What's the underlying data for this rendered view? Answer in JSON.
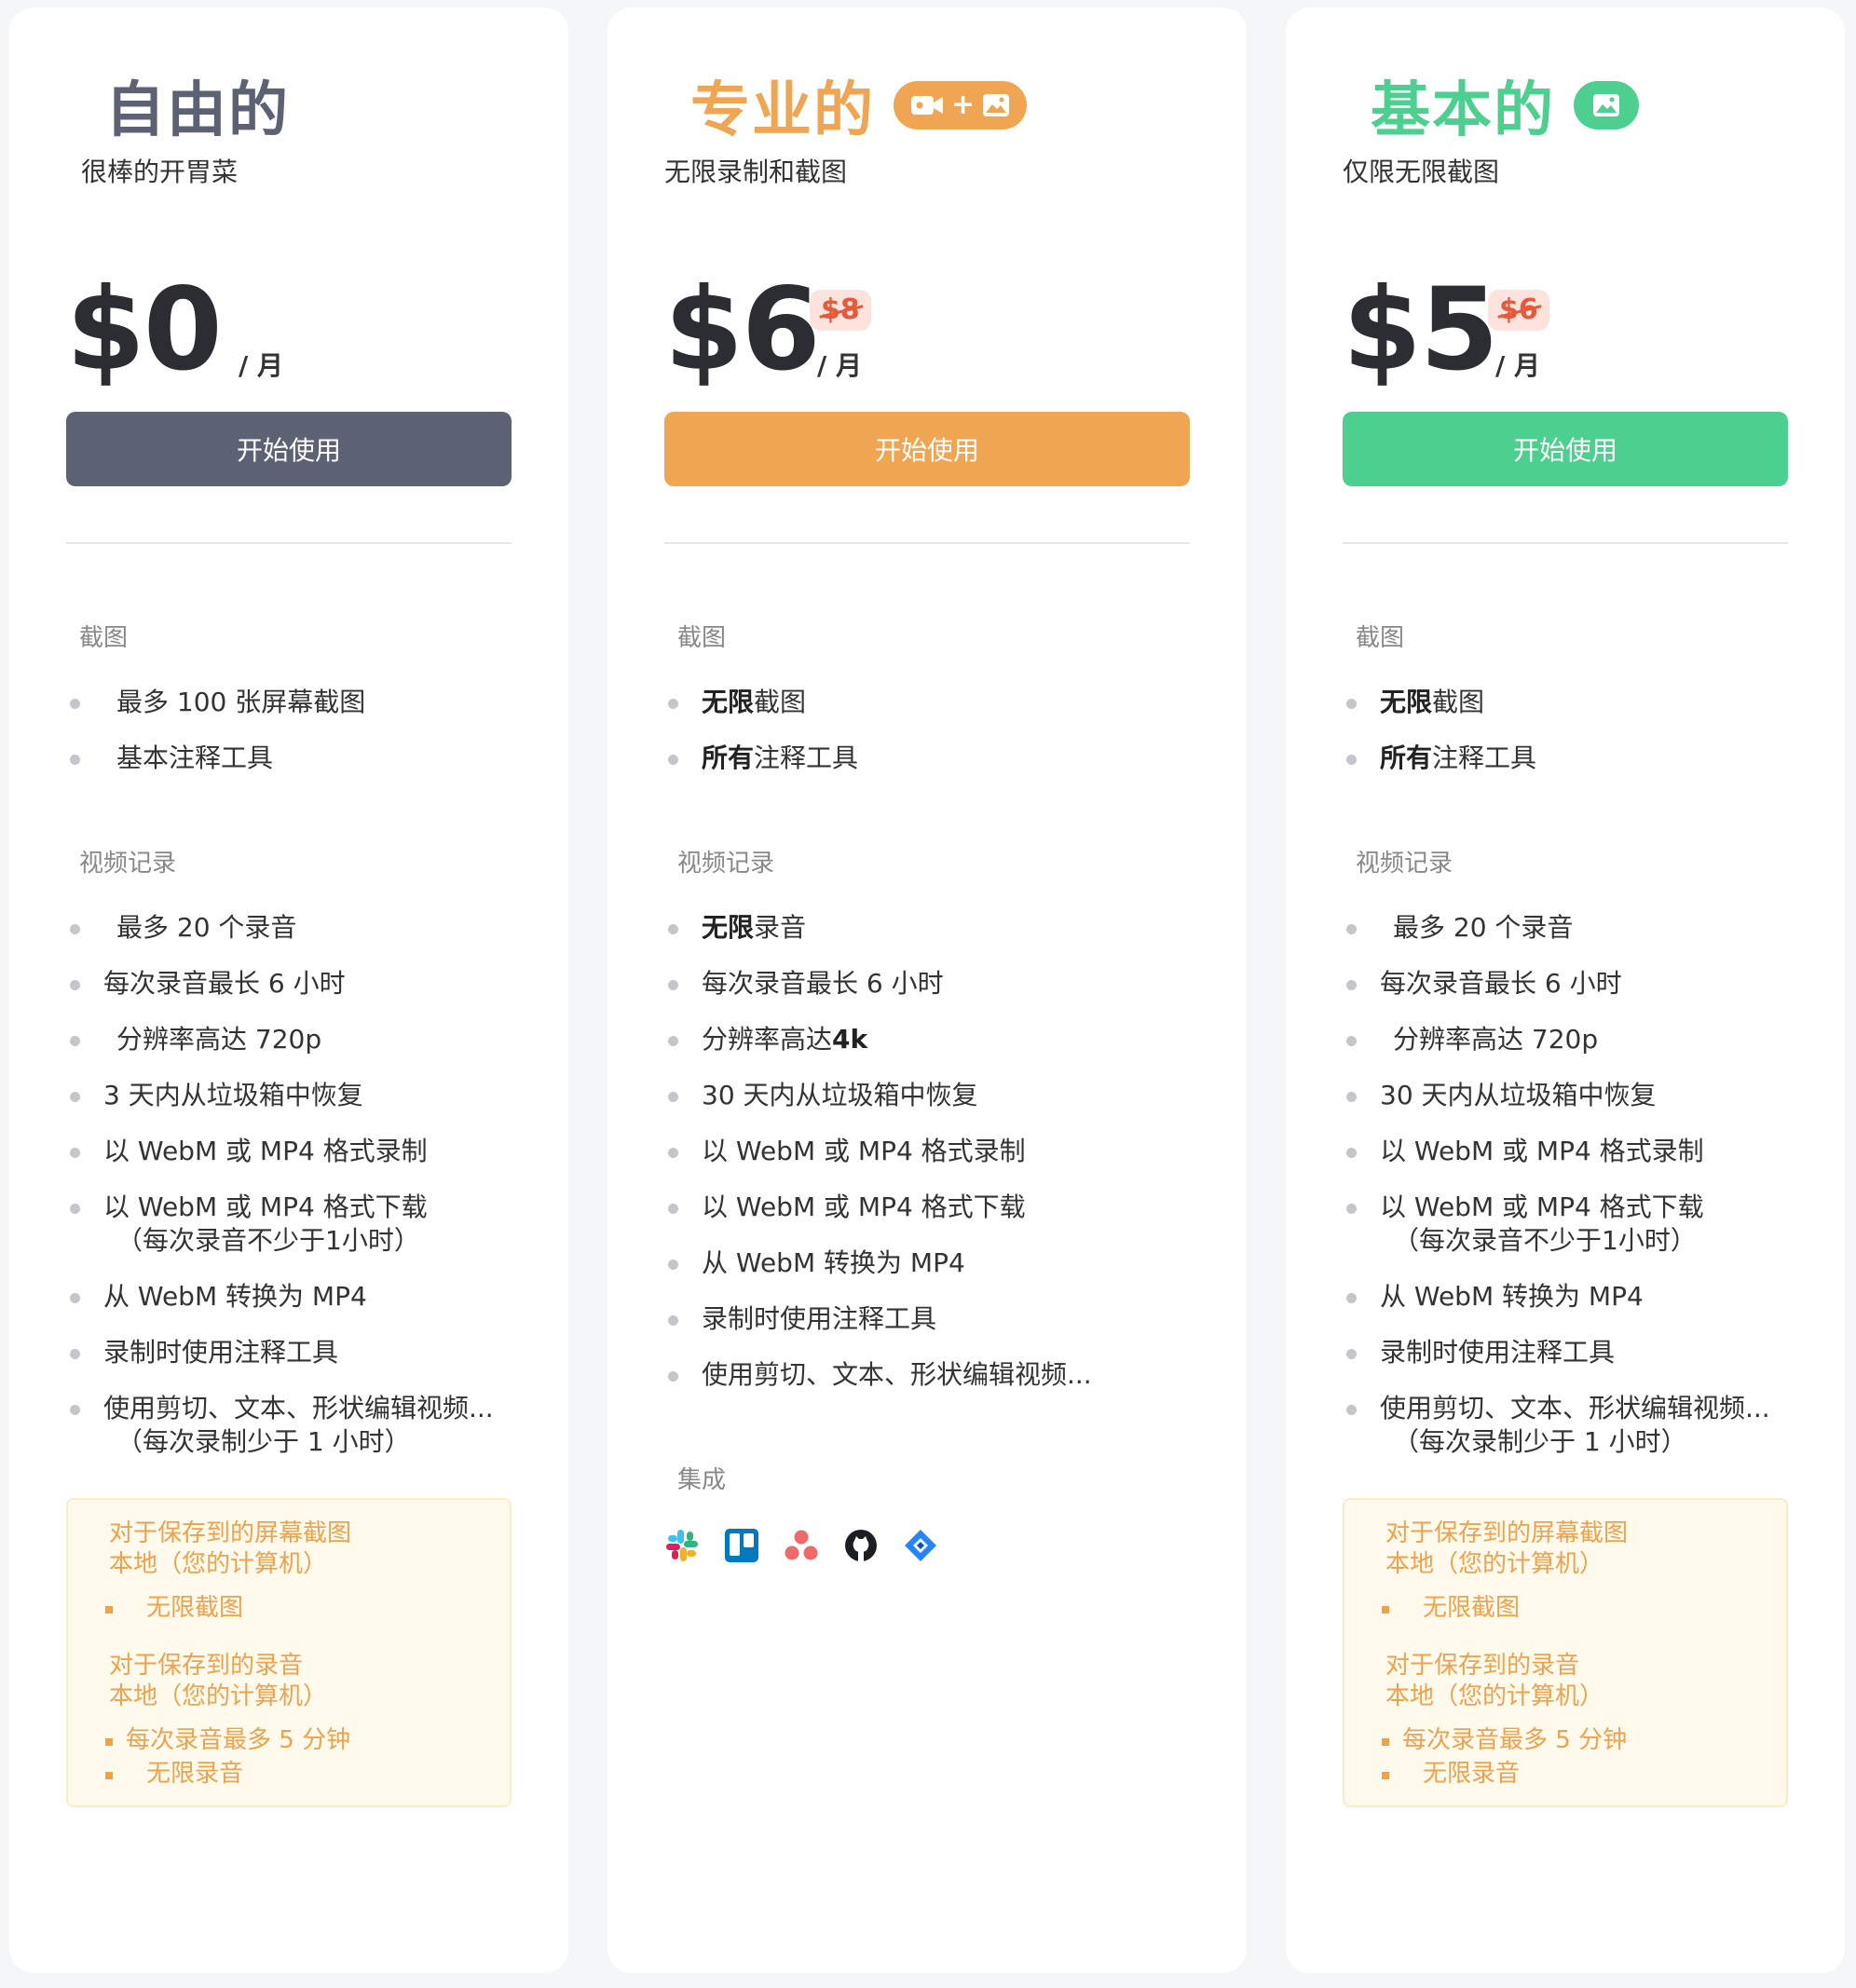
{
  "plans": {
    "free": {
      "title": "自由的",
      "subtitle": "很棒的开胃菜",
      "price": "$0",
      "period": "/ 月",
      "cta": "开始使用",
      "color": "#5d6174",
      "section_screenshots": "截图",
      "screenshots": [
        "最多 100 张屏幕截图",
        "基本注释工具"
      ],
      "section_video": "视频记录",
      "video": {
        "f1": "最多 20 个录音",
        "f2": "每次录音最长 6 小时",
        "f3": "分辨率高达 720p",
        "f4": "3 天内从垃圾箱中恢复",
        "f5": "以 WebM 或 MP4 格式录制",
        "f6": "以 WebM 或 MP4 格式下载",
        "f6_sub": "（每次录音不少于1小时）",
        "f7": "从 WebM 转换为 MP4",
        "f8": "录制时使用注释工具",
        "f9": "使用剪切、文本、形状编辑视频...",
        "f9_sub": "（每次录制少于 1 小时）"
      },
      "local": {
        "screens_head1": "对于保存到的屏幕截图",
        "screens_head2": "本地（您的计算机）",
        "screens_item": "无限截图",
        "rec_head1": "对于保存到的录音",
        "rec_head2": "本地（您的计算机）",
        "rec_item1": "每次录音最多 5 分钟",
        "rec_item2": "无限录音"
      }
    },
    "pro": {
      "title": "专业的",
      "subtitle": "无限录制和截图",
      "price": "$6",
      "old_price": "$8",
      "period": "/ 月",
      "cta": "开始使用",
      "color": "#efa552",
      "badge_icons": [
        "video-camera-icon",
        "plus",
        "image-icon"
      ],
      "section_screenshots": "截图",
      "screenshots": [
        {
          "bold": "无限",
          "rest": "截图"
        },
        {
          "bold": "所有",
          "rest": "注释工具"
        }
      ],
      "section_video": "视频记录",
      "video": {
        "f1_bold": "无限",
        "f1_rest": "录音",
        "f2": "每次录音最长 6 小时",
        "f3_pre": "分辨率高达",
        "f3_bold": "4k",
        "f4": "30 天内从垃圾箱中恢复",
        "f5": "以 WebM 或 MP4 格式录制",
        "f6": "以 WebM 或 MP4 格式下载",
        "f7": "从 WebM 转换为 MP4",
        "f8": "录制时使用注释工具",
        "f9": "使用剪切、文本、形状编辑视频..."
      },
      "section_integrations": "集成",
      "integrations": [
        "slack-icon",
        "trello-icon",
        "asana-icon",
        "github-icon",
        "jira-icon"
      ]
    },
    "basic": {
      "title": "基本的",
      "subtitle": "仅限无限截图",
      "price": "$5",
      "old_price": "$6",
      "period": "/ 月",
      "cta": "开始使用",
      "color": "#4ccf8f",
      "badge_icons": [
        "image-icon"
      ],
      "section_screenshots": "截图",
      "screenshots": [
        {
          "bold": "无限",
          "rest": "截图"
        },
        {
          "bold": "所有",
          "rest": "注释工具"
        }
      ],
      "section_video": "视频记录",
      "video": {
        "f1": "最多 20 个录音",
        "f2": "每次录音最长 6 小时",
        "f3": "分辨率高达 720p",
        "f4": "30 天内从垃圾箱中恢复",
        "f5": "以 WebM 或 MP4 格式录制",
        "f6": "以 WebM 或 MP4 格式下载",
        "f6_sub": "（每次录音不少于1小时）",
        "f7": "从 WebM 转换为 MP4",
        "f8": "录制时使用注释工具",
        "f9": "使用剪切、文本、形状编辑视频...",
        "f9_sub": "（每次录制少于 1 小时）"
      },
      "local": {
        "screens_head1": "对于保存到的屏幕截图",
        "screens_head2": "本地（您的计算机）",
        "screens_item": "无限截图",
        "rec_head1": "对于保存到的录音",
        "rec_head2": "本地（您的计算机）",
        "rec_item1": "每次录音最多 5 分钟",
        "rec_item2": "无限录音"
      }
    }
  },
  "colors": {
    "price_text": "#2b2d33",
    "old_price_bg": "#fde3dc",
    "old_price_text": "#e35b3c",
    "local_box_bg": "#fffaeb",
    "local_box_text": "#eea24e"
  }
}
